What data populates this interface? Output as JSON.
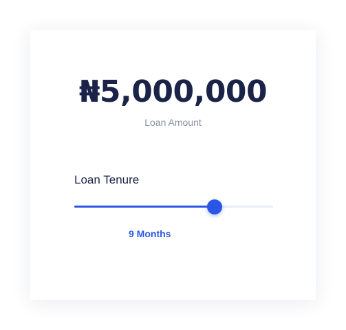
{
  "loan": {
    "amount": "₦5,000,000",
    "amount_label": "Loan Amount"
  },
  "tenure": {
    "label": "Loan Tenure",
    "value_text": "9 Months",
    "slider_fraction": 0.705
  },
  "colors": {
    "accent": "#2b55e6",
    "text_dark": "#1b2448",
    "text_muted": "#8a90a3",
    "track": "#e8ecfb"
  }
}
